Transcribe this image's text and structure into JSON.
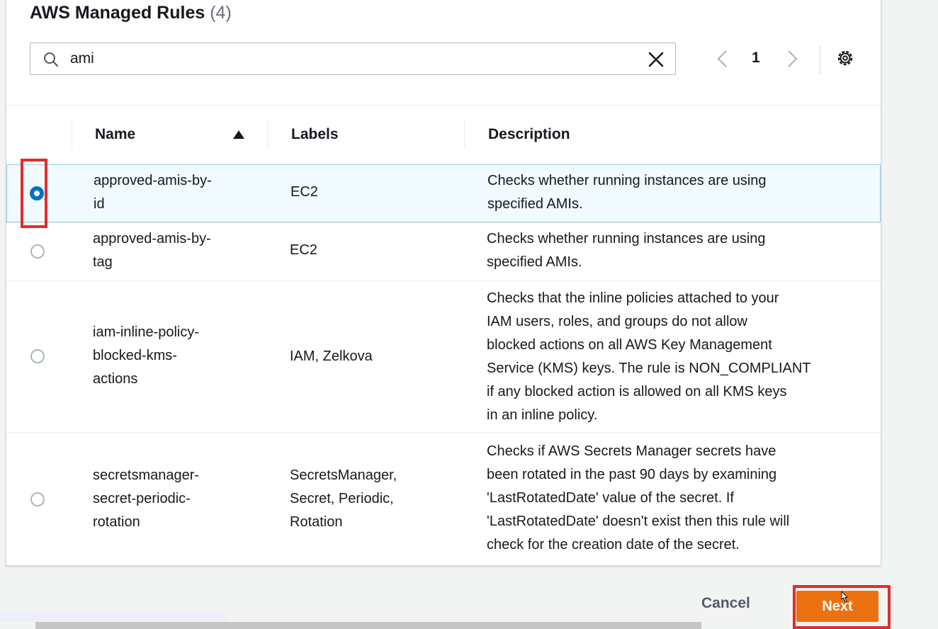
{
  "section": {
    "title": "AWS Managed Rules",
    "count": "(4)"
  },
  "search": {
    "value": "ami",
    "placeholder": ""
  },
  "pagination": {
    "current_page": "1"
  },
  "table": {
    "columns": [
      "Name",
      "Labels",
      "Description"
    ],
    "sort": {
      "column": "Name",
      "direction": "ascending"
    },
    "rows": [
      {
        "name_lines": [
          "approved-amis-by-",
          "id"
        ],
        "labels_lines": [
          "EC2"
        ],
        "description_lines": [
          "Checks whether running instances are using",
          "specified AMIs."
        ],
        "selected": true
      },
      {
        "name_lines": [
          "approved-amis-by-",
          "tag"
        ],
        "labels_lines": [
          "EC2"
        ],
        "description_lines": [
          "Checks whether running instances are using",
          "specified AMIs."
        ],
        "selected": false
      },
      {
        "name_lines": [
          "iam-inline-policy-",
          "blocked-kms-",
          "actions"
        ],
        "labels_lines": [
          "IAM, Zelkova"
        ],
        "description_lines": [
          "Checks that the inline policies attached to your",
          "IAM users, roles, and groups do not allow",
          "blocked actions on all AWS Key Management",
          "Service (KMS) keys. The rule is NON_COMPLIANT",
          "if any blocked action is allowed on all KMS keys",
          "in an inline policy."
        ],
        "selected": false
      },
      {
        "name_lines": [
          "secretsmanager-",
          "secret-periodic-",
          "rotation"
        ],
        "labels_lines": [
          "SecretsManager,",
          "Secret, Periodic,",
          "Rotation"
        ],
        "description_lines": [
          "Checks if AWS Secrets Manager secrets have",
          "been rotated in the past 90 days by examining",
          "'LastRotatedDate' value of the secret. If",
          "'LastRotatedDate' doesn't exist then this rule will",
          "check for the creation date of the secret."
        ],
        "selected": false
      }
    ]
  },
  "footer": {
    "cancel_label": "Cancel",
    "next_label": "Next"
  },
  "colors": {
    "primary_button": "#ec7211",
    "selected_radio": "#0073bb",
    "highlight_box": "#e02d2d",
    "selected_row_bg": "#f1faff"
  },
  "icons": [
    "search-icon",
    "clear-icon",
    "chevron-left-icon",
    "chevron-right-icon",
    "settings-icon",
    "sort-ascending-icon",
    "cursor-icon"
  ]
}
